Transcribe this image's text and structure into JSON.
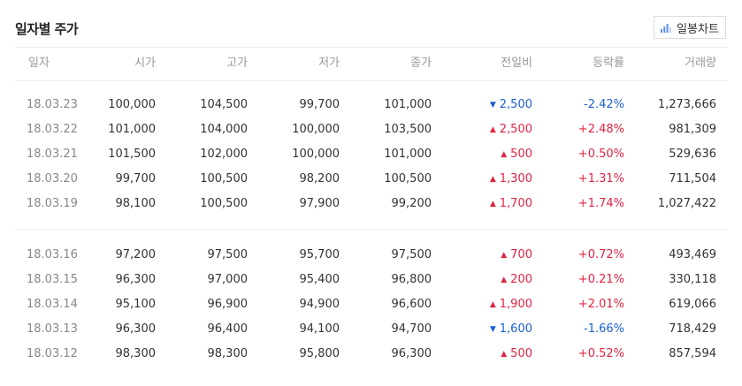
{
  "header": {
    "title": "일자별 주가",
    "chart_button_label": "일봉차트",
    "chart_button_icon": "bar-chart-icon"
  },
  "colors": {
    "up": "#e12343",
    "down": "#1d5fd0",
    "text": "#333333",
    "muted": "#999999"
  },
  "columns": [
    "일자",
    "시가",
    "고가",
    "저가",
    "종가",
    "전일비",
    "등락률",
    "거래량"
  ],
  "groups": [
    [
      {
        "date": "18.03.23",
        "open": "100,000",
        "high": "104,500",
        "low": "99,700",
        "close": "101,000",
        "dir": "down",
        "change": "2,500",
        "rate": "-2.42%",
        "volume": "1,273,666"
      },
      {
        "date": "18.03.22",
        "open": "101,000",
        "high": "104,000",
        "low": "100,000",
        "close": "103,500",
        "dir": "up",
        "change": "2,500",
        "rate": "+2.48%",
        "volume": "981,309"
      },
      {
        "date": "18.03.21",
        "open": "101,500",
        "high": "102,000",
        "low": "100,000",
        "close": "101,000",
        "dir": "up",
        "change": "500",
        "rate": "+0.50%",
        "volume": "529,636"
      },
      {
        "date": "18.03.20",
        "open": "99,700",
        "high": "100,500",
        "low": "98,200",
        "close": "100,500",
        "dir": "up",
        "change": "1,300",
        "rate": "+1.31%",
        "volume": "711,504"
      },
      {
        "date": "18.03.19",
        "open": "98,100",
        "high": "100,500",
        "low": "97,900",
        "close": "99,200",
        "dir": "up",
        "change": "1,700",
        "rate": "+1.74%",
        "volume": "1,027,422"
      }
    ],
    [
      {
        "date": "18.03.16",
        "open": "97,200",
        "high": "97,500",
        "low": "95,700",
        "close": "97,500",
        "dir": "up",
        "change": "700",
        "rate": "+0.72%",
        "volume": "493,469"
      },
      {
        "date": "18.03.15",
        "open": "96,300",
        "high": "97,000",
        "low": "95,400",
        "close": "96,800",
        "dir": "up",
        "change": "200",
        "rate": "+0.21%",
        "volume": "330,118"
      },
      {
        "date": "18.03.14",
        "open": "95,100",
        "high": "96,900",
        "low": "94,900",
        "close": "96,600",
        "dir": "up",
        "change": "1,900",
        "rate": "+2.01%",
        "volume": "619,066"
      },
      {
        "date": "18.03.13",
        "open": "96,300",
        "high": "96,400",
        "low": "94,100",
        "close": "94,700",
        "dir": "down",
        "change": "1,600",
        "rate": "-1.66%",
        "volume": "718,429"
      },
      {
        "date": "18.03.12",
        "open": "98,300",
        "high": "98,300",
        "low": "95,800",
        "close": "96,300",
        "dir": "up",
        "change": "500",
        "rate": "+0.52%",
        "volume": "857,594"
      }
    ]
  ]
}
